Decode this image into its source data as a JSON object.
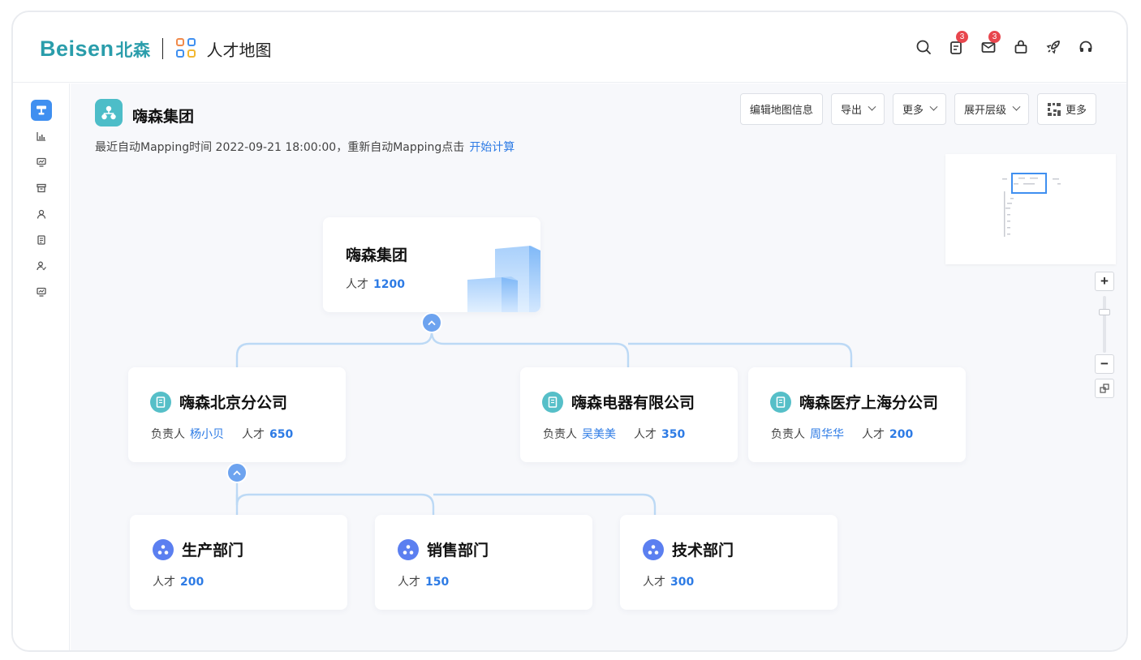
{
  "brand": {
    "logo_latin": "Beisen",
    "logo_cn": "北森",
    "app_title": "人才地图"
  },
  "header_icons": [
    {
      "name": "search-icon",
      "badge": ""
    },
    {
      "name": "clipboard-icon",
      "badge": "3"
    },
    {
      "name": "mail-icon",
      "badge": "3"
    },
    {
      "name": "bag-icon",
      "badge": ""
    },
    {
      "name": "rocket-icon",
      "badge": ""
    },
    {
      "name": "headset-icon",
      "badge": ""
    }
  ],
  "sidebar": {
    "items": [
      "tree-icon",
      "bar-chart-icon",
      "monitor-icon",
      "archive-icon",
      "user-icon",
      "document-icon",
      "user-search-icon",
      "screen-icon"
    ],
    "active_index": 0
  },
  "page": {
    "title": "嗨森集团",
    "subtitle": "最近自动Mapping时间 2022-09-21 18:00:00，重新自动Mapping点击",
    "subtitle_link": "开始计算"
  },
  "toolbar": {
    "edit": "编辑地图信息",
    "export": "导出",
    "more1": "更多",
    "expand": "展开层级",
    "more2": "更多"
  },
  "org": {
    "root": {
      "name": "嗨森集团",
      "talent_label": "人才",
      "talent": "1200"
    },
    "level1": [
      {
        "name": "嗨森北京分公司",
        "owner_label": "负责人",
        "owner": "杨小贝",
        "talent_label": "人才",
        "talent": "650"
      },
      {
        "name": "嗨森电器有限公司",
        "owner_label": "负责人",
        "owner": "吴美美",
        "talent_label": "人才",
        "talent": "350"
      },
      {
        "name": "嗨森医疗上海分公司",
        "owner_label": "负责人",
        "owner": "周华华",
        "talent_label": "人才",
        "talent": "200"
      }
    ],
    "level2": [
      {
        "name": "生产部门",
        "talent_label": "人才",
        "talent": "200"
      },
      {
        "name": "销售部门",
        "talent_label": "人才",
        "talent": "150"
      },
      {
        "name": "技术部门",
        "talent_label": "人才",
        "talent": "300"
      }
    ]
  },
  "zoom": {
    "zoom_in": "+",
    "zoom_out": "−",
    "level_fraction": 0.25
  },
  "colors": {
    "accent": "#2d7be5",
    "teal": "#4dbdc8",
    "badge": "#e8464d",
    "line": "#bcd9f5"
  }
}
